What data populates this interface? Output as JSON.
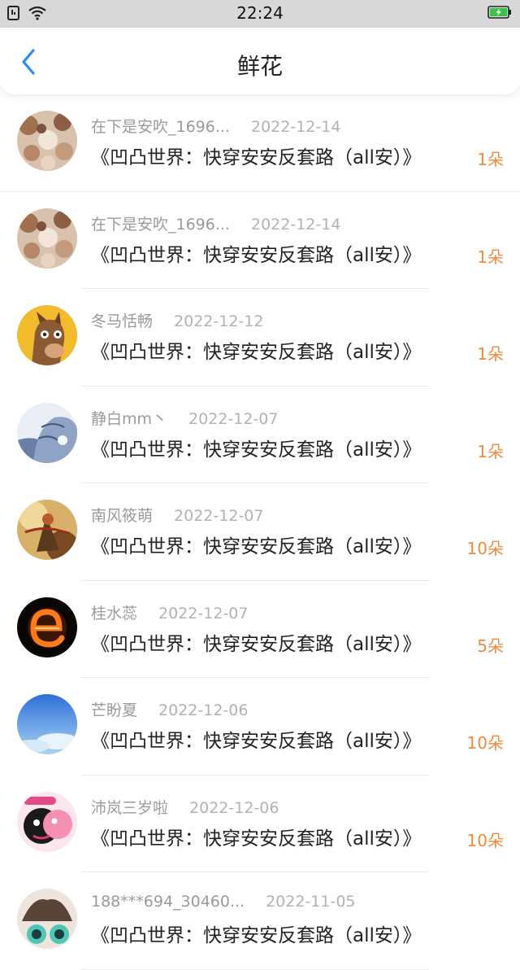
{
  "status_bar": {
    "time": "22:24",
    "icons": [
      "sim-icon",
      "wifi-icon",
      "battery-charging-icon"
    ]
  },
  "header": {
    "title": "鲜花",
    "back_icon": "chevron-left-icon",
    "accent": "#2d8cf0"
  },
  "colors": {
    "count": "#f08a3c",
    "meta": "#9a9a9a",
    "title_text": "#222222"
  },
  "items": [
    {
      "name": "在下是安吹_1696...",
      "date": "2022-12-14",
      "book": "《凹凸世界：快穿安安反套路（all安）》",
      "count": "1朵"
    },
    {
      "name": "在下是安吹_1696...",
      "date": "2022-12-14",
      "book": "《凹凸世界：快穿安安反套路（all安）》",
      "count": "1朵"
    },
    {
      "name": "冬马恬畅",
      "date": "2022-12-12",
      "book": "《凹凸世界：快穿安安反套路（all安）》",
      "count": "1朵"
    },
    {
      "name": "静白mm丶",
      "date": "2022-12-07",
      "book": "《凹凸世界：快穿安安反套路（all安）》",
      "count": "1朵"
    },
    {
      "name": "南风筱萌",
      "date": "2022-12-07",
      "book": "《凹凸世界：快穿安安反套路（all安）》",
      "count": "10朵"
    },
    {
      "name": "桂水蕊",
      "date": "2022-12-07",
      "book": "《凹凸世界：快穿安安反套路（all安）》",
      "count": "5朵"
    },
    {
      "name": "芒盼夏",
      "date": "2022-12-06",
      "book": "《凹凸世界：快穿安安反套路（all安）》",
      "count": "10朵"
    },
    {
      "name": "沛岚三岁啦",
      "date": "2022-12-06",
      "book": "《凹凸世界：快穿安安反套路（all安）》",
      "count": "10朵"
    },
    {
      "name": "188***694_30460...",
      "date": "2022-11-05",
      "book": "《凹凸世界：快穿安安反套路（all安）》",
      "count": ""
    }
  ]
}
